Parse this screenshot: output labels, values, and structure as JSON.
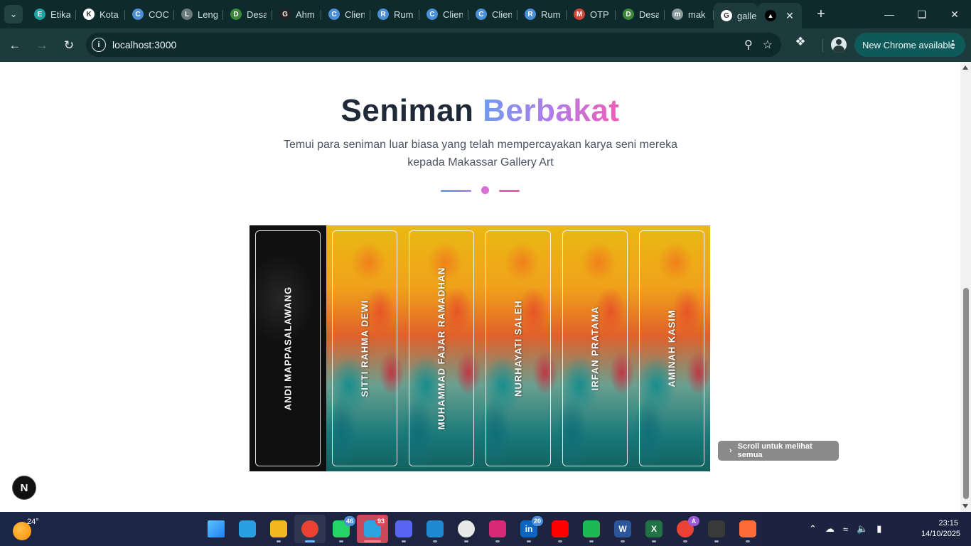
{
  "browser": {
    "tab_search_icon": "chevron-down",
    "tabs": [
      {
        "title": "Etika",
        "favicon_color": "#1aa3a3",
        "favicon_letter": "E"
      },
      {
        "title": "Kota",
        "favicon_color": "#ffffff",
        "favicon_letter": "K"
      },
      {
        "title": "COC",
        "favicon_color": "#4c8fd6",
        "favicon_letter": "C"
      },
      {
        "title": "Leng",
        "favicon_color": "#6b7b7b",
        "favicon_letter": "L"
      },
      {
        "title": "Desa",
        "favicon_color": "#3a8a3a",
        "favicon_letter": "D"
      },
      {
        "title": "Ahm",
        "favicon_color": "#222222",
        "favicon_letter": "G"
      },
      {
        "title": "Clien",
        "favicon_color": "#4a90d9",
        "favicon_letter": "C"
      },
      {
        "title": "Rum",
        "favicon_color": "#4a90d9",
        "favicon_letter": "R"
      },
      {
        "title": "Clien",
        "favicon_color": "#4a90d9",
        "favicon_letter": "C"
      },
      {
        "title": "Clien",
        "favicon_color": "#4a90d9",
        "favicon_letter": "C"
      },
      {
        "title": "Rum",
        "favicon_color": "#4a90d9",
        "favicon_letter": "R"
      },
      {
        "title": "OTP",
        "favicon_color": "#d44638",
        "favicon_letter": "M"
      },
      {
        "title": "Desa",
        "favicon_color": "#3a8a3a",
        "favicon_letter": "D"
      },
      {
        "title": "mak",
        "favicon_color": "#8a9a9a",
        "favicon_letter": "m"
      },
      {
        "title": "galle",
        "favicon_color": "#ffffff",
        "favicon_letter": "G"
      }
    ],
    "active_tab_title": "",
    "url": "localhost:3000",
    "update_label": "New Chrome available"
  },
  "page": {
    "heading_plain": "Seniman",
    "heading_gradient": "Berbakat",
    "subtitle": "Temui para seniman luar biasa yang telah mempercayakan karya seni mereka kepada Makassar Gallery Art",
    "artists": [
      {
        "name": "ANDI MAPPASALAWANG",
        "style": "dark"
      },
      {
        "name": "SITTI RAHMA DEWI",
        "style": "paint"
      },
      {
        "name": "MUHAMMAD FAJAR RAMADHAN",
        "style": "paint"
      },
      {
        "name": "NURHAYATI SALEH",
        "style": "paint"
      },
      {
        "name": "IRFAN PRATAMA",
        "style": "paint"
      },
      {
        "name": "AMINAH KASIM",
        "style": "paint"
      }
    ],
    "scroll_hint": "Scroll untuk melihat semua",
    "next_badge": "N"
  },
  "taskbar": {
    "weather_temp": "24°",
    "apps": [
      {
        "name": "start",
        "color": "#3aa0ff",
        "letter": "",
        "badge": ""
      },
      {
        "name": "search",
        "color": "#2aa0e0",
        "letter": "",
        "badge": ""
      },
      {
        "name": "file-explorer",
        "color": "#f2b721",
        "letter": "",
        "badge": ""
      },
      {
        "name": "chrome",
        "color": "#ea4335",
        "letter": "",
        "badge": ""
      },
      {
        "name": "whatsapp",
        "color": "#25d366",
        "letter": "",
        "badge": "46"
      },
      {
        "name": "telegram",
        "color": "#2aa3e0",
        "letter": "",
        "badge": "93"
      },
      {
        "name": "discord",
        "color": "#5865f2",
        "letter": "",
        "badge": ""
      },
      {
        "name": "vscode",
        "color": "#1f8ad2",
        "letter": "",
        "badge": ""
      },
      {
        "name": "steam",
        "color": "#e8e8e8",
        "letter": "",
        "badge": ""
      },
      {
        "name": "instagram",
        "color": "#d62976",
        "letter": "",
        "badge": ""
      },
      {
        "name": "linkedin",
        "color": "#0a66c2",
        "letter": "in",
        "badge": "20"
      },
      {
        "name": "youtube",
        "color": "#ff0000",
        "letter": "",
        "badge": ""
      },
      {
        "name": "spotify",
        "color": "#1db954",
        "letter": "",
        "badge": ""
      },
      {
        "name": "word",
        "color": "#2b579a",
        "letter": "W",
        "badge": ""
      },
      {
        "name": "excel",
        "color": "#217346",
        "letter": "X",
        "badge": ""
      },
      {
        "name": "chrome-profile",
        "color": "#ea4335",
        "letter": "",
        "badge": "A"
      },
      {
        "name": "terminal",
        "color": "#3a3a3a",
        "letter": "",
        "badge": ""
      },
      {
        "name": "postman",
        "color": "#ff6c37",
        "letter": "",
        "badge": ""
      }
    ],
    "clock_time": "23:15",
    "clock_date": "14/10/2025"
  }
}
